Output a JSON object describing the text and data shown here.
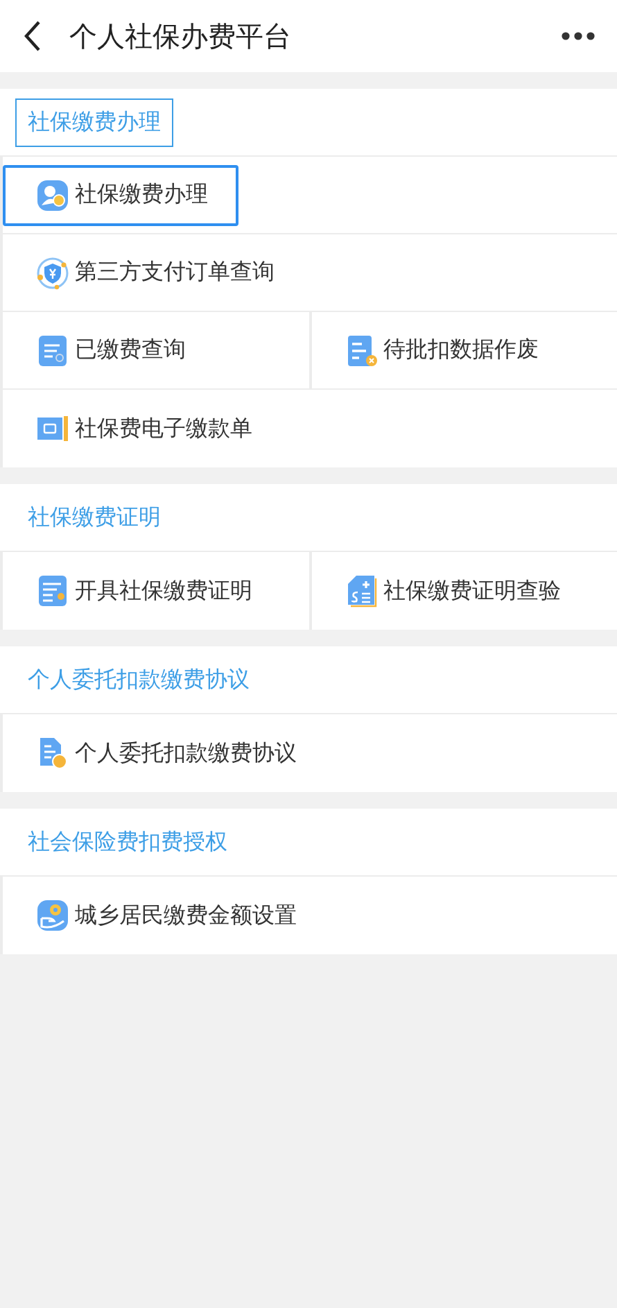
{
  "header": {
    "title": "个人社保办费平台"
  },
  "sections": [
    {
      "title": "社保缴费办理",
      "focused": true,
      "rows": [
        [
          {
            "label": "社保缴费办理",
            "kind": "person",
            "focused": true
          }
        ],
        [
          {
            "label": "第三方支付订单查询",
            "kind": "shield",
            "focused": false
          }
        ],
        [
          {
            "label": "已缴费查询",
            "kind": "doclist",
            "focused": false
          },
          {
            "label": "待批扣数据作废",
            "kind": "docx",
            "focused": false
          }
        ],
        [
          {
            "label": "社保费电子缴款单",
            "kind": "ticket",
            "focused": false
          }
        ]
      ]
    },
    {
      "title": "社保缴费证明",
      "focused": false,
      "rows": [
        [
          {
            "label": "开具社保缴费证明",
            "kind": "cert",
            "focused": false
          },
          {
            "label": "社保缴费证明查验",
            "kind": "dollar",
            "focused": false
          }
        ]
      ]
    },
    {
      "title": "个人委托扣款缴费协议",
      "focused": false,
      "rows": [
        [
          {
            "label": "个人委托扣款缴费协议",
            "kind": "doccoin",
            "focused": false
          }
        ]
      ]
    },
    {
      "title": "社会保险费扣费授权",
      "focused": false,
      "rows": [
        [
          {
            "label": "城乡居民缴费金额设置",
            "kind": "hand",
            "focused": false
          }
        ]
      ]
    }
  ]
}
